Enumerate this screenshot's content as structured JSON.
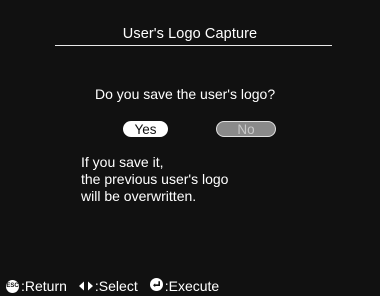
{
  "dialog": {
    "title": "User's Logo Capture",
    "question": "Do you save the user's logo?",
    "buttons": {
      "yes_label": "Yes",
      "no_label": "No"
    },
    "message_lines": [
      "If you save it,",
      "the previous user's logo",
      "will be overwritten."
    ]
  },
  "footer": {
    "esc_icon_text": "ESC",
    "return_label": ":Return",
    "select_label": ":Select",
    "execute_label": ":Execute"
  },
  "icons": {
    "esc": "esc-button-icon",
    "select": "left-right-arrows-icon",
    "execute": "enter-icon"
  },
  "colors": {
    "background": "#111111",
    "text": "#ffffff",
    "selected_button_bg": "#ffffff",
    "disabled_button_bg": "#8a8a8a"
  }
}
